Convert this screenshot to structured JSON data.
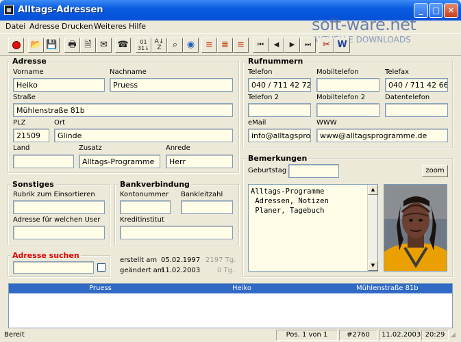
{
  "window": {
    "title": "Alltags-Adressen",
    "icon_text": "▦"
  },
  "menu": [
    "Datei",
    "Adresse",
    "Drucken",
    "Weiteres",
    "Hilfe"
  ],
  "watermark": {
    "main": "soft-ware.net",
    "sub": "AKTUELLE DOWNLOADS"
  },
  "adresse": {
    "title": "Adresse",
    "vorname_label": "Vorname",
    "vorname": "Heiko",
    "nachname_label": "Nachname",
    "nachname": "Pruess",
    "strasse_label": "Straße",
    "strasse": "Mühlenstraße 81b",
    "plz_label": "PLZ",
    "plz": "21509",
    "ort_label": "Ort",
    "ort": "Glinde",
    "land_label": "Land",
    "land": "",
    "zusatz_label": "Zusatz",
    "zusatz": "Alltags-Programme",
    "anrede_label": "Anrede",
    "anrede": "Herr"
  },
  "rufnummern": {
    "title": "Rufnummern",
    "telefon_label": "Telefon",
    "telefon": "040 / 711 42 721",
    "mobil_label": "Mobiltelefon",
    "mobil": "",
    "telefax_label": "Telefax",
    "telefax": "040 / 711 42 662",
    "telefon2_label": "Telefon 2",
    "telefon2": "",
    "mobil2_label": "Mobiltelefon 2",
    "mobil2": "",
    "daten_label": "Datentelefon",
    "daten": "",
    "email_label": "eMail",
    "email": "info@alltagsprog",
    "www_label": "WWW",
    "www": "www@alltagsprogramme.de"
  },
  "sonstiges": {
    "title": "Sonstiges",
    "rubrik_label": "Rubrik zum Einsortieren",
    "rubrik": "",
    "user_label": "Adresse für welchen User",
    "user": ""
  },
  "bank": {
    "title": "Bankverbindung",
    "konto_label": "Kontonummer",
    "konto": "",
    "blz_label": "Bankleitzahl",
    "blz": "",
    "institut_label": "Kreditinstitut",
    "institut": ""
  },
  "bemerkungen": {
    "title": "Bemerkungen",
    "geburtstag_label": "Geburtstag",
    "geburtstag": "",
    "zoom_label": "zoom",
    "memo": "Alltags-Programme\n Adressen, Notizen\n Planer, Tagebuch"
  },
  "suche": {
    "title": "Adresse suchen",
    "value": ""
  },
  "meta": {
    "erstellt_label": "erstellt am",
    "erstellt": "05.02.1997",
    "erstellt_tage": "2197 Tg.",
    "geaendert_label": "geändert am",
    "geaendert": "11.02.2003",
    "geaendert_tage": "0 Tg."
  },
  "list": {
    "row": [
      "Pruess",
      "Heiko",
      "Mühlenstraße 81b"
    ]
  },
  "status": {
    "left": "Bereit",
    "pos": "Pos. 1 von 1",
    "id": "#2760",
    "date": "11.02.2003",
    "time": "20:29"
  },
  "colors": {
    "title_bar": "#0a5ce0",
    "search_title": "#e00000",
    "selection": "#316ac5",
    "field_bg": "#fffde8"
  }
}
